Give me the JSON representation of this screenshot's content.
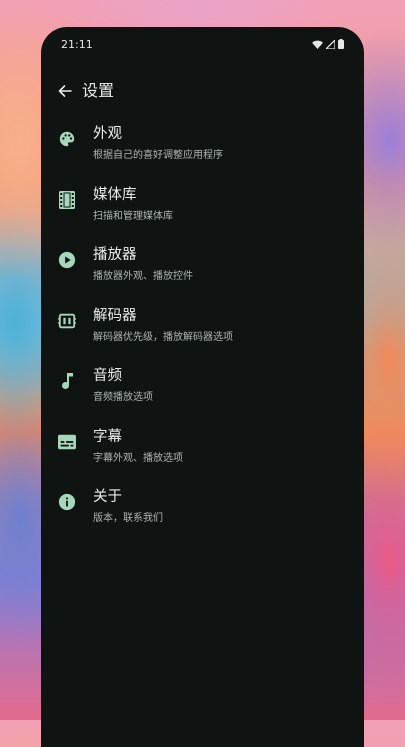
{
  "status_bar": {
    "time": "21:11",
    "icons": [
      "wifi-icon",
      "signal-icon",
      "battery-icon"
    ]
  },
  "app_bar": {
    "title": "设置",
    "back_icon": "arrow-back-icon"
  },
  "accent_color": "#a6d6bc",
  "settings": [
    {
      "icon": "palette-icon",
      "title": "外观",
      "subtitle": "根据自己的喜好调整应用程序"
    },
    {
      "icon": "film-strip-icon",
      "title": "媒体库",
      "subtitle": "扫描和管理媒体库"
    },
    {
      "icon": "play-circle-icon",
      "title": "播放器",
      "subtitle": "播放器外观、播放控件"
    },
    {
      "icon": "memory-chip-icon",
      "title": "解码器",
      "subtitle": "解码器优先级，播放解码器选项"
    },
    {
      "icon": "music-note-icon",
      "title": "音频",
      "subtitle": "音频播放选项"
    },
    {
      "icon": "subtitles-icon",
      "title": "字幕",
      "subtitle": "字幕外观、播放选项"
    },
    {
      "icon": "info-icon",
      "title": "关于",
      "subtitle": "版本，联系我们"
    }
  ]
}
